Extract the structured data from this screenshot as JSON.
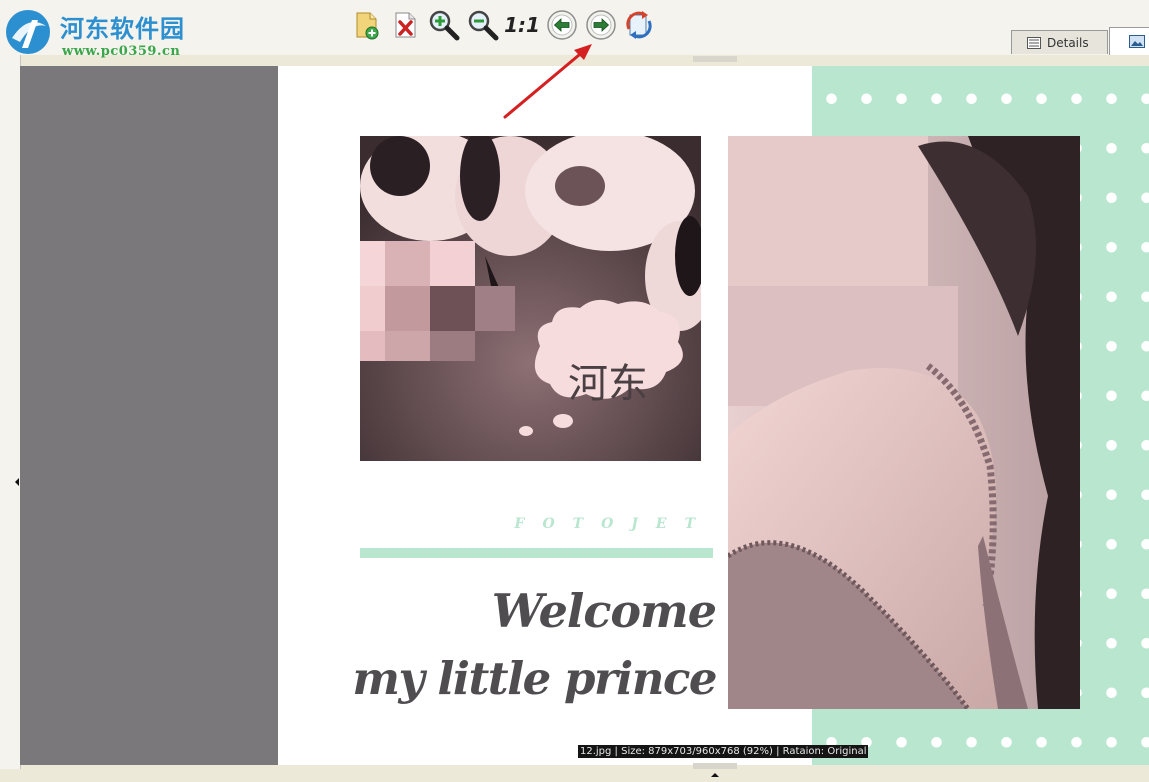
{
  "watermark": {
    "site_name": "河东软件园",
    "site_url": "www.pc0359.cn"
  },
  "toolbar": {
    "buttons": [
      {
        "name": "add-folder",
        "icon": "folder-add-icon"
      },
      {
        "name": "delete",
        "icon": "file-delete-icon"
      },
      {
        "name": "zoom-in",
        "icon": "zoom-in-icon"
      },
      {
        "name": "zoom-out",
        "icon": "zoom-out-icon"
      },
      {
        "name": "actual-size",
        "icon": "actual-size-icon",
        "label": "1:1"
      },
      {
        "name": "previous",
        "icon": "arrow-left-icon"
      },
      {
        "name": "next",
        "icon": "arrow-right-icon"
      },
      {
        "name": "rotate",
        "icon": "rotate-icon"
      }
    ]
  },
  "tabs": {
    "details_label": "Details",
    "preview_icon": "image-preview-icon",
    "active": "preview"
  },
  "image": {
    "bubble_text": "河东",
    "brand": "FOTOJET",
    "headline_line1": "Welcome",
    "headline_line2": "my little prince",
    "colors": {
      "mint": "#b8e6cf",
      "headline": "#4f4d50",
      "photo_tint": "#d9b8b8"
    }
  },
  "status": {
    "text": "12.jpg  |  Size: 879x703/960x768 (92%)  |  Rataion: Original"
  },
  "annotation": {
    "arrow_color": "#d42020",
    "points_to": "next-button"
  }
}
